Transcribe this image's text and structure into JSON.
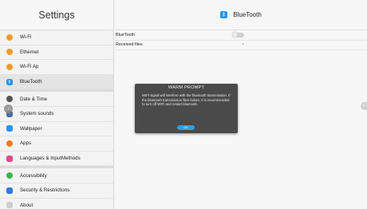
{
  "sidebar": {
    "title": "Settings",
    "items": [
      {
        "label": "Wi-Fi",
        "icon": "wifi-icon",
        "color": "#f29a28"
      },
      {
        "label": "Ethernet",
        "icon": "ethernet-icon",
        "color": "#f29a28"
      },
      {
        "label": "Wi-Fi Ap",
        "icon": "hotspot-icon",
        "color": "#f29a28"
      },
      {
        "label": "BlueTooth",
        "icon": "bluetooth-icon",
        "color": "#2196f3"
      },
      {
        "label": "Date & Time",
        "icon": "clock-icon",
        "color": "#555555"
      },
      {
        "label": "System sounds",
        "icon": "sound-icon",
        "color": "#4a6fa5"
      },
      {
        "label": "Wallpaper",
        "icon": "wallpaper-icon",
        "color": "#2196f3"
      },
      {
        "label": "Apps",
        "icon": "apps-icon",
        "color": "#f07a20"
      },
      {
        "label": "Languages & InputMethods",
        "icon": "language-icon",
        "color": "#e04a8a"
      },
      {
        "label": "Accessibility",
        "icon": "accessibility-icon",
        "color": "#3cb54a"
      },
      {
        "label": "Security & Restrictions",
        "icon": "security-icon",
        "color": "#2f7ad8"
      },
      {
        "label": "About",
        "icon": "about-icon",
        "color": "#cfcfcf"
      }
    ],
    "selected_index": 3
  },
  "main": {
    "title": "BlueTooth",
    "bluetooth_toggle_on": false,
    "rows": [
      {
        "label": "BlueTooth"
      },
      {
        "label": "Received files",
        "chevron": ">"
      }
    ]
  },
  "dialog": {
    "title": "WARM PROMPT",
    "message": "WIFI signal will interfere with the bluetooth transmission. If the bluetooth transmission files failure, it is recommended to turn off WIFI and restart bluetooth.",
    "ok_label": "OK",
    "accent": "#2aa0e8"
  },
  "edge_handle_glyph": "<"
}
